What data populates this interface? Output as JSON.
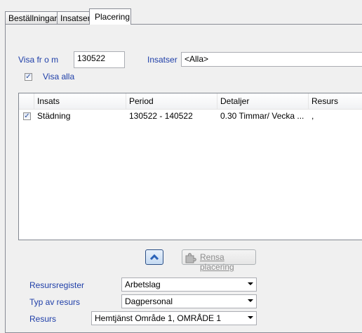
{
  "tabs": [
    {
      "label": "Beställningar",
      "active": false
    },
    {
      "label": "Insatser",
      "active": false
    },
    {
      "label": "Placering",
      "active": true
    }
  ],
  "filter": {
    "visa_from_label": "Visa fr o m",
    "visa_from_value": "130522",
    "insatser_label": "Insatser",
    "insatser_value": "<Alla>",
    "visa_alla_label": "Visa alla",
    "visa_alla_checked": true
  },
  "list": {
    "columns": [
      "Insats",
      "Period",
      "Detaljer",
      "Resurs"
    ],
    "rows": [
      {
        "checked": true,
        "insats": "Städning",
        "period": "130522 - 140522",
        "detaljer": "0.30 Timmar/ Vecka ...",
        "resurs": ","
      }
    ]
  },
  "actions": {
    "rensa_label": "Rensa placering"
  },
  "form": {
    "resursregister_label": "Resursregister",
    "resursregister_value": "Arbetslag",
    "typ_label": "Typ av resurs",
    "typ_value": "Dagpersonal",
    "resurs_label": "Resurs",
    "resurs_value": "Hemtjänst Område 1, OMRÅDE 1"
  },
  "colors": {
    "label_blue": "#1e3ea8",
    "up_button_blue": "#2a62b8"
  },
  "icons": {
    "up": "chevron-up-icon",
    "rensa": "puzzle-icon"
  }
}
